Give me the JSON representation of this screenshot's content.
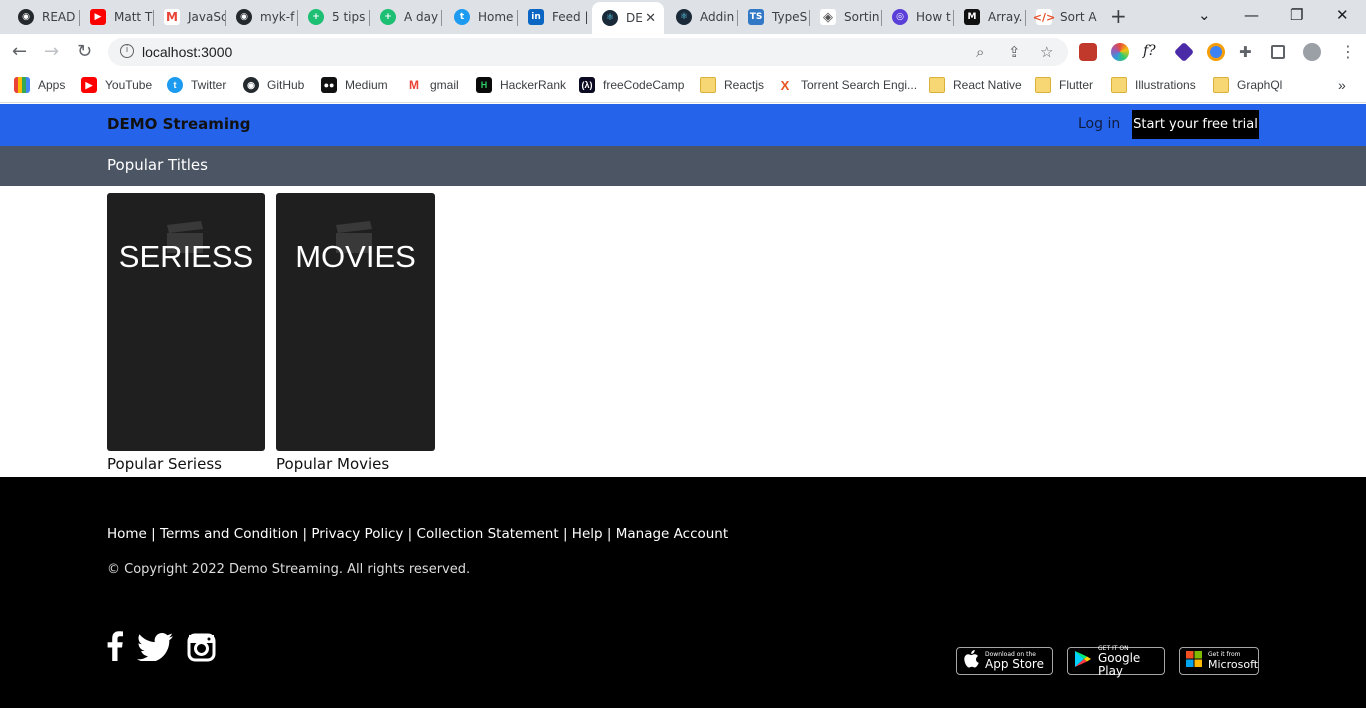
{
  "browser": {
    "tabs": [
      {
        "title": "READ",
        "icon": "github-icon",
        "color": "#24292e"
      },
      {
        "title": "Matt T",
        "icon": "youtube-icon",
        "color": "#ff0000"
      },
      {
        "title": "JavaSc",
        "icon": "gmail-icon",
        "color": "#ea4335"
      },
      {
        "title": "myk-f",
        "icon": "github-icon",
        "color": "#24292e"
      },
      {
        "title": "5 tips",
        "icon": "plus-icon",
        "color": "#1dbf73"
      },
      {
        "title": "A day",
        "icon": "plus-icon",
        "color": "#1dbf73"
      },
      {
        "title": "Home",
        "icon": "twitter-icon",
        "color": "#1d9bf0"
      },
      {
        "title": "Feed |",
        "icon": "linkedin-icon",
        "color": "#0a66c2"
      },
      {
        "title": "DE",
        "icon": "react-icon",
        "color": "#1b2a38",
        "active": true
      },
      {
        "title": "Addin",
        "icon": "react-icon",
        "color": "#1b2a38"
      },
      {
        "title": "TypeS",
        "icon": "typescript-icon",
        "color": "#3178c6"
      },
      {
        "title": "Sortin",
        "icon": "diamond-icon",
        "color": "#555555"
      },
      {
        "title": "How t",
        "icon": "hashnode-icon",
        "color": "#5b3fd9"
      },
      {
        "title": "Array.",
        "icon": "medium-icon",
        "color": "#111111"
      },
      {
        "title": "Sort A",
        "icon": "code-icon",
        "color": "#e44d26"
      }
    ],
    "url": "localhost:3000",
    "bookmarks": [
      {
        "label": "Apps",
        "icon": "apps-icon",
        "color": "#4285f4"
      },
      {
        "label": "YouTube",
        "icon": "youtube-icon",
        "color": "#ff0000"
      },
      {
        "label": "Twitter",
        "icon": "twitter-icon",
        "color": "#1d9bf0"
      },
      {
        "label": "GitHub",
        "icon": "github-icon",
        "color": "#24292e"
      },
      {
        "label": "Medium",
        "icon": "medium-icon",
        "color": "#111111"
      },
      {
        "label": "gmail",
        "icon": "gmail-icon",
        "color": "#ea4335"
      },
      {
        "label": "HackerRank",
        "icon": "hackerrank-icon",
        "color": "#0a0a0a"
      },
      {
        "label": "freeCodeCamp",
        "icon": "freecodecamp-icon",
        "color": "#0a0a23"
      },
      {
        "label": "Reactjs",
        "icon": "folder-icon",
        "color": "#f7d774"
      },
      {
        "label": "Torrent Search Engi...",
        "icon": "torrent-icon",
        "color": "#e8541f"
      },
      {
        "label": "React Native",
        "icon": "folder-icon",
        "color": "#f7d774"
      },
      {
        "label": "Flutter",
        "icon": "folder-icon",
        "color": "#f7d774"
      },
      {
        "label": "Illustrations",
        "icon": "folder-icon",
        "color": "#f7d774"
      },
      {
        "label": "GraphQl",
        "icon": "folder-icon",
        "color": "#f7d774"
      }
    ]
  },
  "header": {
    "brand": "DEMO Streaming",
    "login": "Log in",
    "cta": "Start your free trial",
    "bg_color": "#2563eb"
  },
  "subheader": {
    "title": "Popular Titles"
  },
  "cards": [
    {
      "word": "SERIESS",
      "label": "Popular Seriess"
    },
    {
      "word": "MOVIES",
      "label": "Popular Movies"
    }
  ],
  "footer": {
    "links": [
      "Home",
      "Terms and Condition",
      "Privacy Policy",
      "Collection Statement",
      "Help",
      "Manage Account"
    ],
    "separator": "|",
    "copyright": "© Copyright 2022 Demo Streaming. All rights reserved.",
    "social": [
      "facebook-icon",
      "twitter-icon",
      "instagram-icon"
    ],
    "stores": [
      {
        "small": "Download on the",
        "big": "App Store",
        "icon": "apple-icon"
      },
      {
        "small": "GET IT ON",
        "big": "Google Play",
        "icon": "google-play-icon"
      },
      {
        "small": "Get it from",
        "big": "Microsoft",
        "icon": "microsoft-icon"
      }
    ]
  }
}
